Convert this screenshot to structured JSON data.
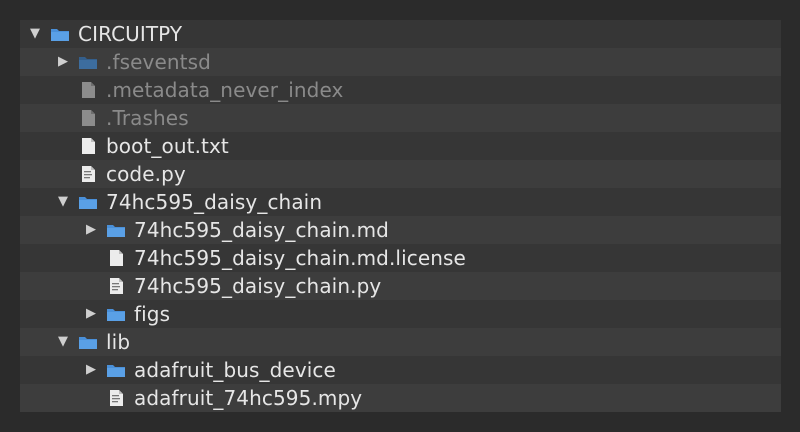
{
  "colors": {
    "folder": "#4a90d9",
    "folder_dim": "#3a6fa5",
    "file": "#e8e8e8",
    "file_dim": "#8c8c8c",
    "text": "#e6e6e6",
    "text_dim": "#8a8a8a"
  },
  "rows": [
    {
      "label": "CIRCUITPY",
      "icon": "folder-icon",
      "expanded": true
    },
    {
      "label": ".fseventsd",
      "icon": "folder-icon",
      "expanded": false
    },
    {
      "label": ".metadata_never_index",
      "icon": "file-icon"
    },
    {
      "label": ".Trashes",
      "icon": "file-icon"
    },
    {
      "label": "boot_out.txt",
      "icon": "file-icon"
    },
    {
      "label": "code.py",
      "icon": "python-file-icon"
    },
    {
      "label": "74hc595_daisy_chain",
      "icon": "folder-icon",
      "expanded": true
    },
    {
      "label": "74hc595_daisy_chain.md",
      "icon": "folder-icon",
      "expanded": false
    },
    {
      "label": "74hc595_daisy_chain.md.license",
      "icon": "file-icon"
    },
    {
      "label": "74hc595_daisy_chain.py",
      "icon": "python-file-icon"
    },
    {
      "label": "figs",
      "icon": "folder-icon",
      "expanded": false
    },
    {
      "label": "lib",
      "icon": "folder-icon",
      "expanded": true
    },
    {
      "label": "adafruit_bus_device",
      "icon": "folder-icon",
      "expanded": false
    },
    {
      "label": "adafruit_74hc595.mpy",
      "icon": "python-file-icon"
    }
  ]
}
